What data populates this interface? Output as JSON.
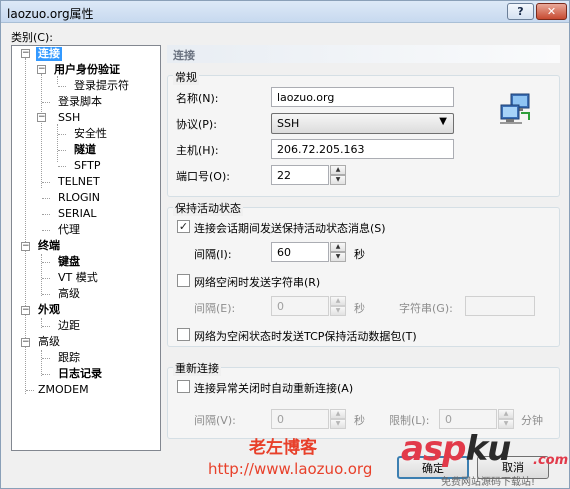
{
  "window": {
    "title": "laozuo.org属性",
    "help_label": "?",
    "close_label": "✕"
  },
  "category_label": "类别(C):",
  "tree": [
    {
      "label": "连接"
    },
    {
      "label": "用户身份验证"
    },
    {
      "label": "登录提示符"
    },
    {
      "label": "登录脚本"
    },
    {
      "label": "SSH"
    },
    {
      "label": "安全性"
    },
    {
      "label": "隧道"
    },
    {
      "label": "SFTP"
    },
    {
      "label": "TELNET"
    },
    {
      "label": "RLOGIN"
    },
    {
      "label": "SERIAL"
    },
    {
      "label": "代理"
    },
    {
      "label": "终端"
    },
    {
      "label": "键盘"
    },
    {
      "label": "VT 模式"
    },
    {
      "label": "高级"
    },
    {
      "label": "外观"
    },
    {
      "label": "边距"
    },
    {
      "label": "高级"
    },
    {
      "label": "跟踪"
    },
    {
      "label": "日志记录"
    },
    {
      "label": "ZMODEM"
    }
  ],
  "content_title": "连接",
  "general": {
    "title": "常规",
    "name_label": "名称(N):",
    "name_value": "laozuo.org",
    "protocol_label": "协议(P):",
    "protocol_value": "SSH",
    "host_label": "主机(H):",
    "host_value": "206.72.205.163",
    "port_label": "端口号(O):",
    "port_value": "22"
  },
  "keepalive": {
    "title": "保持活动状态",
    "send_msg_label": "连接会话期间发送保持活动状态消息(S)",
    "send_msg_checked": true,
    "interval_label": "间隔(I):",
    "interval_value": "60",
    "seconds": "秒",
    "send_str_label": "网络空闲时发送字符串(R)",
    "send_str_checked": false,
    "interval2_label": "间隔(E):",
    "interval2_value": "0",
    "seconds2": "秒",
    "string_label": "字符串(G):",
    "string_value": "",
    "tcp_label": "网络为空闲状态时发送TCP保持活动数据包(T)",
    "tcp_checked": false
  },
  "reconnect": {
    "title": "重新连接",
    "auto_label": "连接异常关闭时自动重新连接(A)",
    "auto_checked": false,
    "interval_label": "间隔(V):",
    "interval_value": "0",
    "seconds": "秒",
    "limit_label": "限制(L):",
    "limit_value": "0",
    "minutes": "分钟"
  },
  "buttons": {
    "ok": "确定",
    "cancel": "取消"
  },
  "watermarks": {
    "brand": "老左博客",
    "url": "http://www.laozuo.org",
    "asp": "asp",
    "ku": "ku",
    "com": ".com",
    "sub": "免费网站源码下载站!"
  }
}
